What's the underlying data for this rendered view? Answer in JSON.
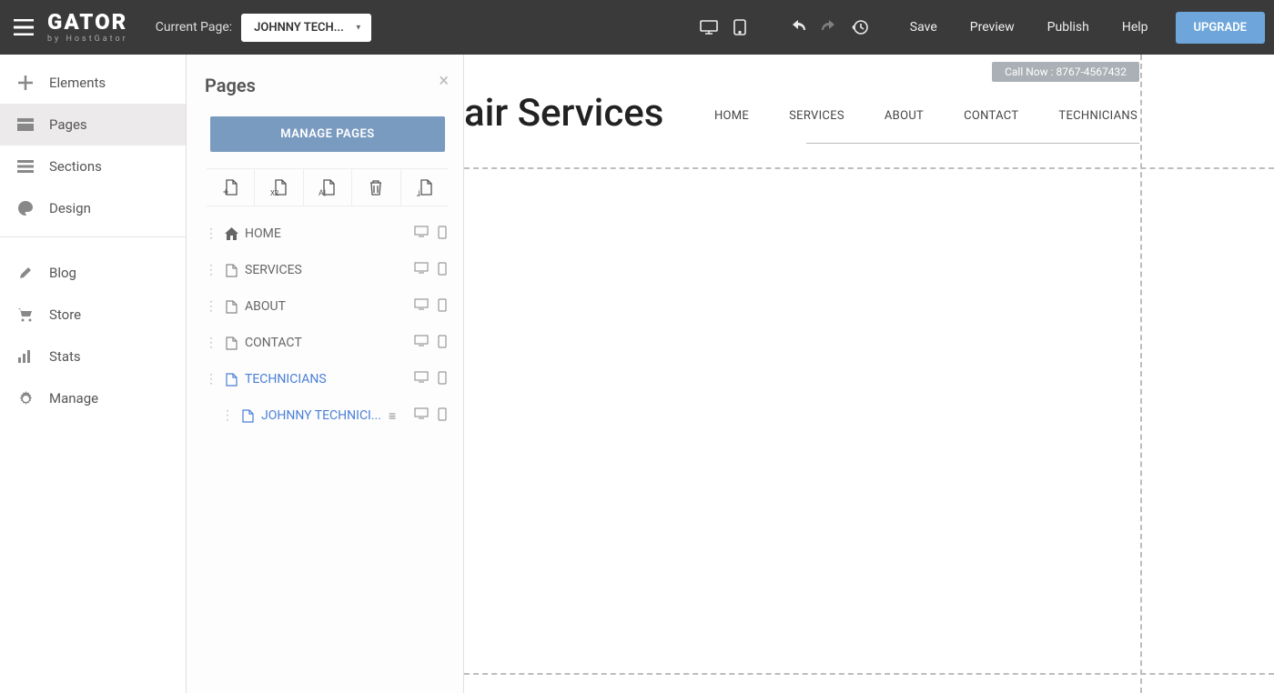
{
  "topbar": {
    "logo_main": "GATOR",
    "logo_sub": "by HostGator",
    "current_page_label": "Current Page:",
    "current_page_value": "JOHNNY TECH...",
    "save": "Save",
    "preview": "Preview",
    "publish": "Publish",
    "help": "Help",
    "upgrade": "UPGRADE"
  },
  "sidebar": {
    "items": [
      {
        "label": "Elements",
        "icon": "plus"
      },
      {
        "label": "Pages",
        "icon": "pages",
        "active": true
      },
      {
        "label": "Sections",
        "icon": "sections"
      },
      {
        "label": "Design",
        "icon": "palette"
      }
    ],
    "items2": [
      {
        "label": "Blog",
        "icon": "pencil"
      },
      {
        "label": "Store",
        "icon": "cart"
      },
      {
        "label": "Stats",
        "icon": "bars"
      },
      {
        "label": "Manage",
        "icon": "gear"
      }
    ]
  },
  "pages_panel": {
    "title": "Pages",
    "manage_label": "MANAGE PAGES",
    "actions": [
      "add-page",
      "duplicate-page",
      "rename-page",
      "delete-page",
      "page-code"
    ],
    "list": [
      {
        "name": "HOME",
        "icon": "home"
      },
      {
        "name": "SERVICES",
        "icon": "file"
      },
      {
        "name": "ABOUT",
        "icon": "file"
      },
      {
        "name": "CONTACT",
        "icon": "file"
      },
      {
        "name": "TECHNICIANS",
        "icon": "file",
        "selected": true
      },
      {
        "name": "JOHNNY TECHNICI...",
        "icon": "file",
        "child": true,
        "menu": true
      }
    ]
  },
  "canvas": {
    "call_now": "Call Now : 8767-4567432",
    "title_visible": "air Services",
    "nav": [
      "HOME",
      "SERVICES",
      "ABOUT",
      "CONTACT",
      "TECHNICIANS"
    ]
  }
}
